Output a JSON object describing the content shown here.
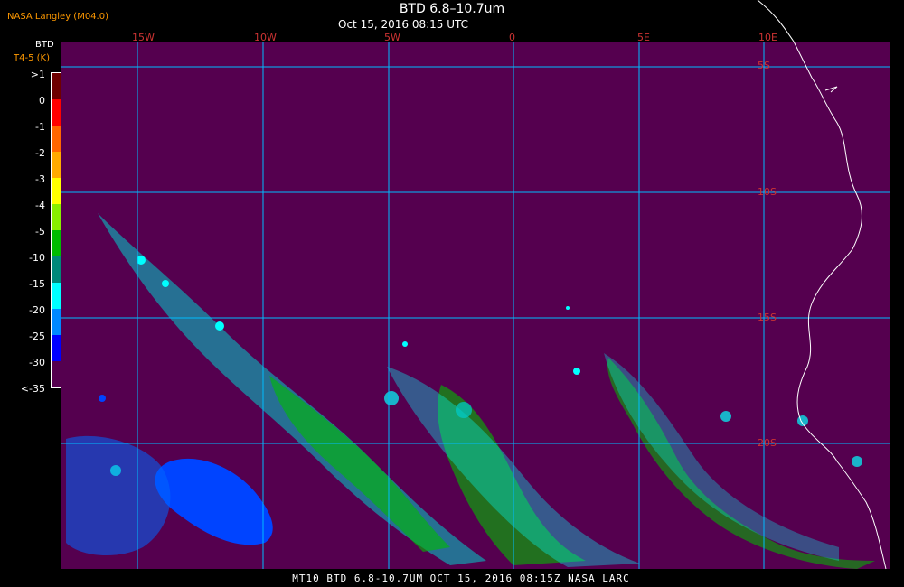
{
  "header": {
    "source": "NASA Langley (M04.0)",
    "title": "BTD 6.8–10.7um",
    "subtitle": "Oct 15, 2016 08:15 UTC"
  },
  "legend": {
    "title": "BTD",
    "subtitle": "T4-5 (K)",
    "colors": [
      "#6e0000",
      "#ff0000",
      "#ff6600",
      "#ffaa00",
      "#ffff00",
      "#88ee00",
      "#00bb00",
      "#00887a",
      "#00ffff",
      "#0088ff",
      "#0000ff",
      "#55004f"
    ],
    "labels": [
      ">1",
      "0",
      "-1",
      "-2",
      "-3",
      "-4",
      "-5",
      "-10",
      "-15",
      "-20",
      "-25",
      "-30",
      "<-35"
    ]
  },
  "map": {
    "background": "#55004f",
    "grid_color": "#00bbff",
    "longitude_labels": [
      "15W",
      "10W",
      "5W",
      "0",
      "5E",
      "10E"
    ],
    "latitude_labels": [
      "5S",
      "10S",
      "15S",
      "20S"
    ],
    "coast_color": "#ffffff"
  },
  "footer": {
    "text": "MT10  BTD 6.8-10.7UM  OCT 15, 2016 08:15Z  NASA LARC"
  }
}
